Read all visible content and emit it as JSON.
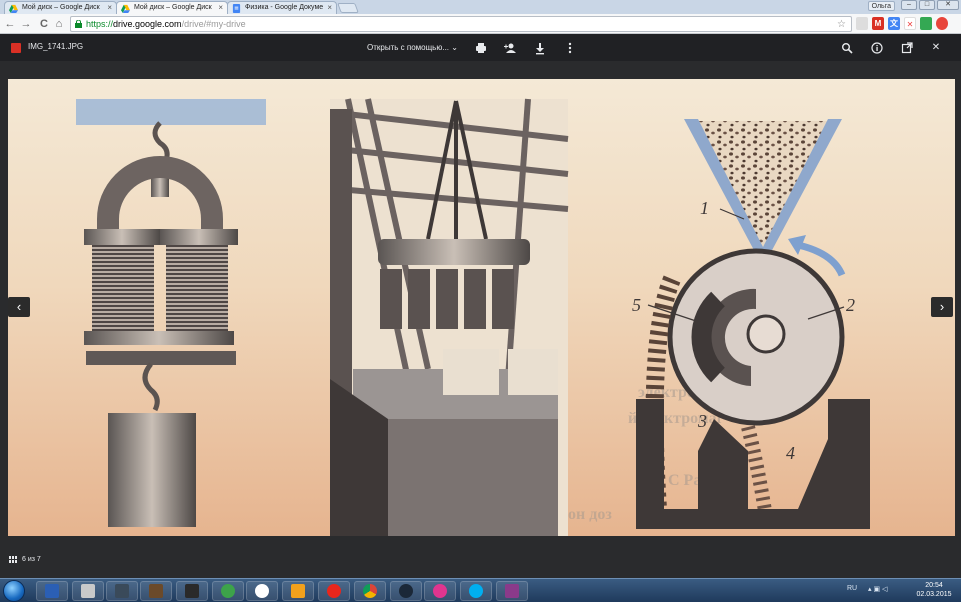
{
  "browser": {
    "tabs": [
      {
        "title": "Мой диск – Google Диск",
        "active": false,
        "icon": "google-drive-icon"
      },
      {
        "title": "Мой диск – Google Диск",
        "active": true,
        "icon": "google-drive-icon"
      },
      {
        "title": "Физика - Google Докуме",
        "active": false,
        "icon": "google-docs-icon"
      }
    ],
    "tab_close": "×",
    "user_name": "Ольга",
    "window_buttons": {
      "minimize": "–",
      "maximize": "□",
      "close": "✕"
    },
    "url_https": "https://",
    "url_host": "drive.google.com",
    "url_path": "/drive/#my-drive",
    "nav": {
      "back": "←",
      "forward": "→",
      "reload": "C",
      "home": "⌂"
    },
    "star": "☆"
  },
  "viewer": {
    "filename": "IMG_1741.JPG",
    "open_with": "Открыть с помощью...",
    "open_with_caret": "⌄",
    "prev": "‹",
    "next": "›",
    "page_indicator": "6 из 7",
    "close": "✕"
  },
  "figure": {
    "labels": [
      "1",
      "5",
      "2",
      "3",
      "4"
    ],
    "bg_text_lines": [
      "электромагн",
      "й электромаг",
      "С Ра",
      "он доз"
    ]
  },
  "taskbar": {
    "apps": [
      "word",
      "counter-strike",
      "game-1",
      "game-2",
      "game-3",
      "tree-app",
      "chat",
      "notes",
      "opera",
      "chrome",
      "steam",
      "itunes",
      "skype",
      "winrar"
    ],
    "lang": "RU",
    "time": "20:54",
    "date": "02.03.2015"
  },
  "colors": {
    "viewer_bg": "#202124",
    "https_green": "#0a8a2a",
    "taskbar": "#1f3a5c"
  }
}
